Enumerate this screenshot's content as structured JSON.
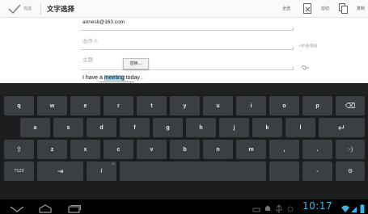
{
  "action_bar": {
    "done_label": "完成",
    "title": "文字选择",
    "select_all_label": "全选",
    "cut_label": "剪切",
    "copy_label": "复制"
  },
  "compose": {
    "from_value": "annesli@163.com",
    "to_hint": "收件人",
    "cc_bcc_label": "+抄送/密送",
    "subject_hint": "主题",
    "paste_popup_label": "替换...",
    "body_before": "I have a ",
    "body_selected": "meeting",
    "body_after": " today ."
  },
  "keyboard": {
    "rows": [
      [
        "q",
        "w",
        "e",
        "r",
        "t",
        "y",
        "u",
        "i",
        "o",
        "p"
      ],
      [
        "a",
        "s",
        "d",
        "f",
        "g",
        "h",
        "j",
        "k",
        "l"
      ],
      [
        "z",
        "x",
        "c",
        "v",
        "b",
        "n",
        "m",
        ",",
        "."
      ]
    ],
    "symbols_label": "?123",
    "tab_symbol": "⇥",
    "slash": "/",
    "at_alt": "@",
    "dash": "-",
    "quote_alt": "\"",
    "underscore_alt": "_",
    "excl_alt": "!",
    "question_alt": "?",
    "smiley": ":-)",
    "shift_symbol": "⇧",
    "backspace_symbol": "⌫",
    "enter_symbol": "↵",
    "settings_symbol": "⚙"
  },
  "status_bar": {
    "clock": "10:17"
  },
  "colors": {
    "accent": "#39b4e6",
    "selection": "#9fd3ec",
    "key_bg": "#3b3e42",
    "keyboard_bg": "#1b1d1f"
  }
}
